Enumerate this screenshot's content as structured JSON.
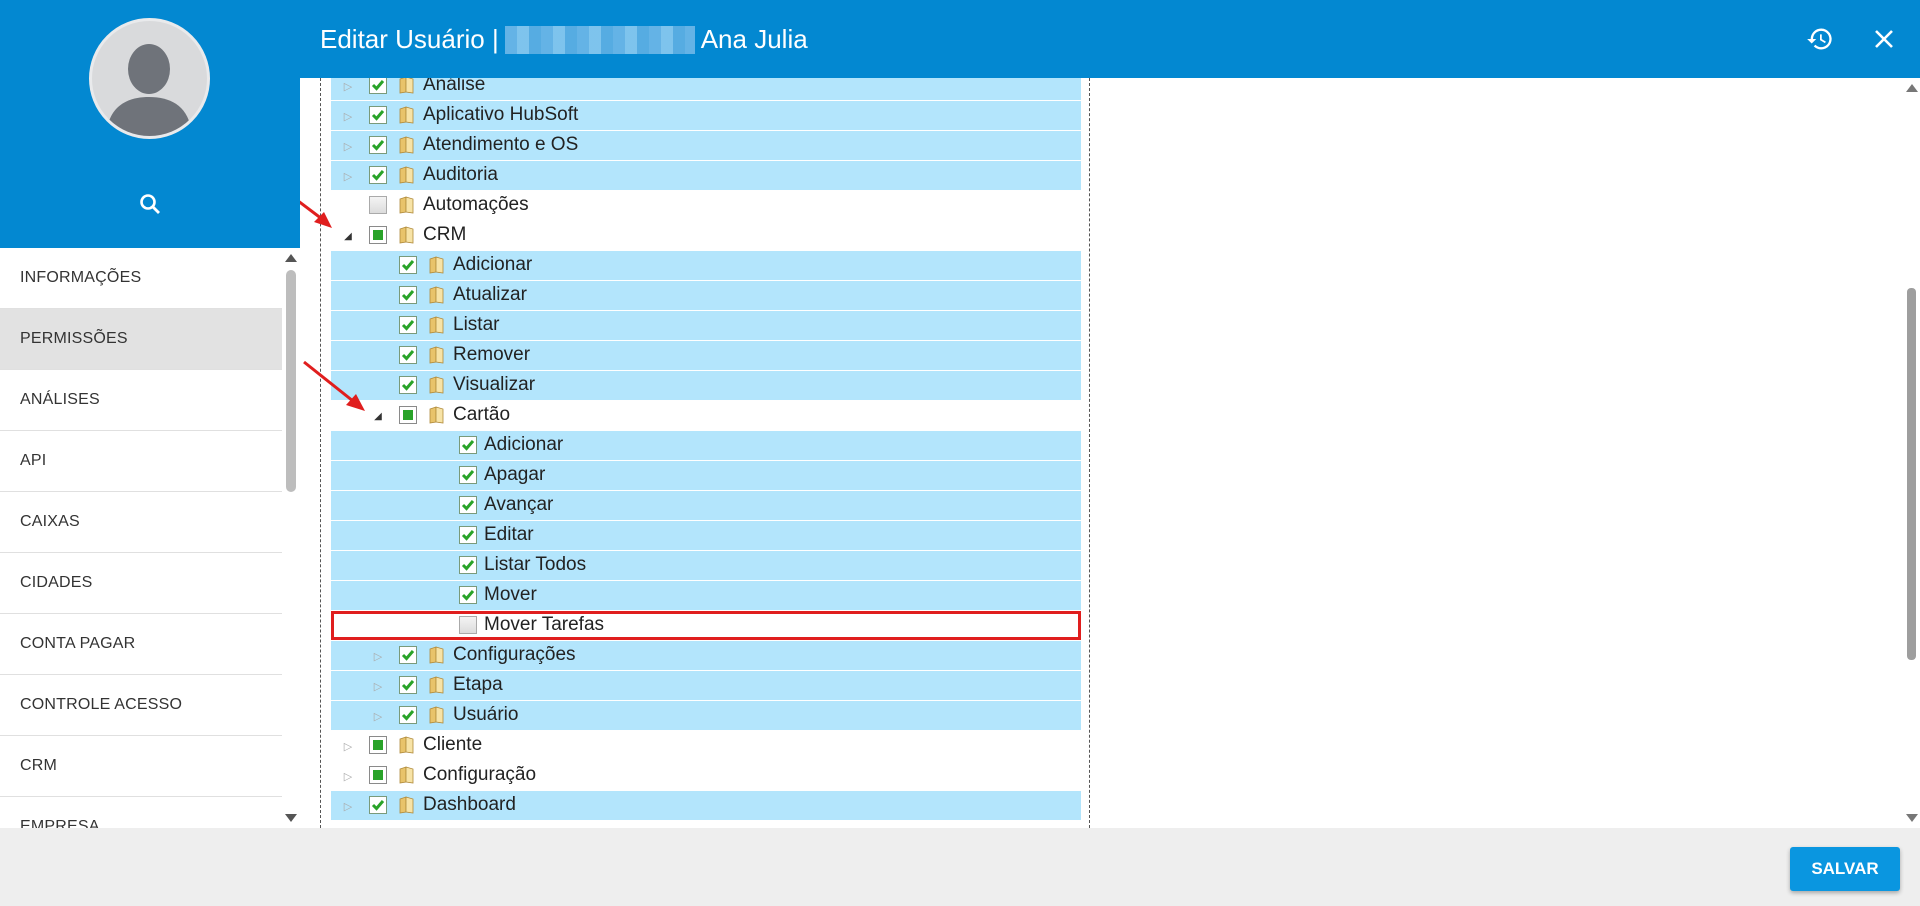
{
  "header": {
    "title_prefix": "Editar Usuário |",
    "user_name": "Ana Julia",
    "history_icon": "history-icon",
    "close_icon": "close-icon"
  },
  "sidebar": {
    "avatar_icon": "user-avatar-icon",
    "search_icon": "search-icon",
    "items": [
      {
        "label": "INFORMAÇÕES"
      },
      {
        "label": "PERMISSÕES",
        "active": true
      },
      {
        "label": "ANÁLISES"
      },
      {
        "label": "API"
      },
      {
        "label": "CAIXAS"
      },
      {
        "label": "CIDADES"
      },
      {
        "label": "CONTA PAGAR"
      },
      {
        "label": "CONTROLE ACESSO"
      },
      {
        "label": "CRM"
      },
      {
        "label": "EMPRESA"
      }
    ]
  },
  "tree": {
    "rows": [
      {
        "label": "Análise",
        "level": 0,
        "expander": "closed",
        "check": "checked",
        "folder": true,
        "selected": true
      },
      {
        "label": "Aplicativo HubSoft",
        "level": 0,
        "expander": "closed",
        "check": "checked",
        "folder": true,
        "selected": true
      },
      {
        "label": "Atendimento e OS",
        "level": 0,
        "expander": "closed",
        "check": "checked",
        "folder": true,
        "selected": true
      },
      {
        "label": "Auditoria",
        "level": 0,
        "expander": "closed",
        "check": "checked",
        "folder": true,
        "selected": true
      },
      {
        "label": "Automações",
        "level": 0,
        "expander": "none",
        "check": "empty",
        "folder": true,
        "selected": false
      },
      {
        "label": "CRM",
        "level": 0,
        "expander": "open",
        "check": "partial",
        "folder": true,
        "selected": false
      },
      {
        "label": "Adicionar",
        "level": 1,
        "expander": "none",
        "check": "checked",
        "folder": true,
        "selected": true
      },
      {
        "label": "Atualizar",
        "level": 1,
        "expander": "none",
        "check": "checked",
        "folder": true,
        "selected": true
      },
      {
        "label": "Listar",
        "level": 1,
        "expander": "none",
        "check": "checked",
        "folder": true,
        "selected": true
      },
      {
        "label": "Remover",
        "level": 1,
        "expander": "none",
        "check": "checked",
        "folder": true,
        "selected": true
      },
      {
        "label": "Visualizar",
        "level": 1,
        "expander": "none",
        "check": "checked",
        "folder": true,
        "selected": true
      },
      {
        "label": "Cartão",
        "level": 1,
        "expander": "open",
        "check": "partial",
        "folder": true,
        "selected": false
      },
      {
        "label": "Adicionar",
        "level": 2,
        "expander": "none",
        "check": "checked",
        "folder": false,
        "selected": true
      },
      {
        "label": "Apagar",
        "level": 2,
        "expander": "none",
        "check": "checked",
        "folder": false,
        "selected": true
      },
      {
        "label": "Avançar",
        "level": 2,
        "expander": "none",
        "check": "checked",
        "folder": false,
        "selected": true
      },
      {
        "label": "Editar",
        "level": 2,
        "expander": "none",
        "check": "checked",
        "folder": false,
        "selected": true
      },
      {
        "label": "Listar Todos",
        "level": 2,
        "expander": "none",
        "check": "checked",
        "folder": false,
        "selected": true
      },
      {
        "label": "Mover",
        "level": 2,
        "expander": "none",
        "check": "checked",
        "folder": false,
        "selected": true
      },
      {
        "label": "Mover Tarefas",
        "level": 2,
        "expander": "none",
        "check": "empty",
        "folder": false,
        "selected": false,
        "highlighted": true
      },
      {
        "label": "Configurações",
        "level": 1,
        "expander": "closed",
        "check": "checked",
        "folder": true,
        "selected": true
      },
      {
        "label": "Etapa",
        "level": 1,
        "expander": "closed",
        "check": "checked",
        "folder": true,
        "selected": true
      },
      {
        "label": "Usuário",
        "level": 1,
        "expander": "closed",
        "check": "checked",
        "folder": true,
        "selected": true
      },
      {
        "label": "Cliente",
        "level": 0,
        "expander": "closed",
        "check": "partial",
        "folder": true,
        "selected": false
      },
      {
        "label": "Configuração",
        "level": 0,
        "expander": "closed",
        "check": "partial",
        "folder": true,
        "selected": false
      },
      {
        "label": "Dashboard",
        "level": 0,
        "expander": "closed",
        "check": "checked",
        "folder": true,
        "selected": true
      }
    ]
  },
  "footer": {
    "save_label": "SALVAR"
  },
  "colors": {
    "primary": "#0388d1",
    "selected_row": "#b3e5fc",
    "highlight_border": "#e01e1e",
    "check_green": "#29a329",
    "save_button": "#0a96e0"
  }
}
